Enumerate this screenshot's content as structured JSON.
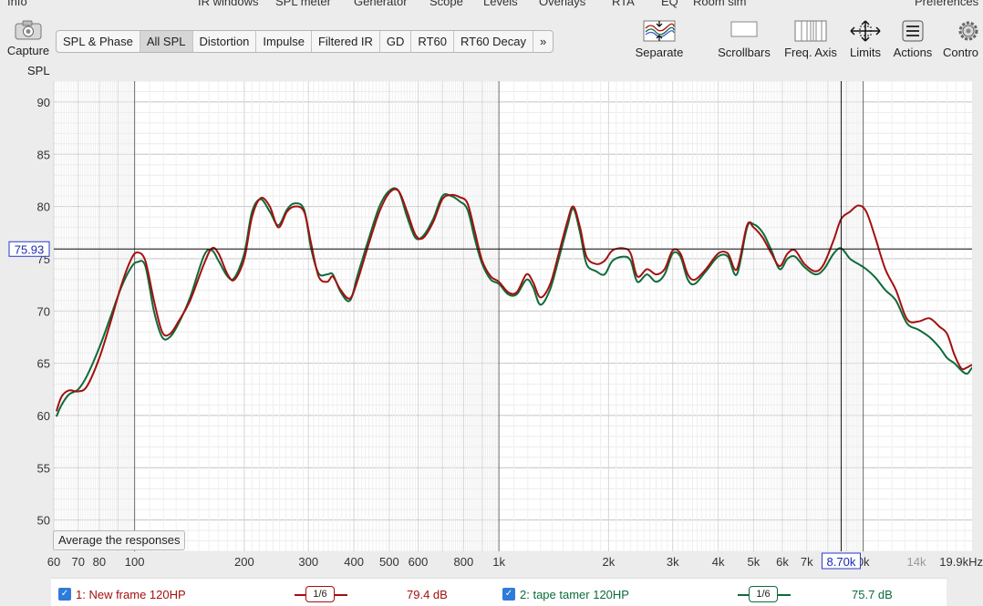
{
  "menu_top": [
    "Info",
    "IR windows",
    "SPL meter",
    "Generator",
    "Scope",
    "Levels",
    "Overlays",
    "RTA",
    "EQ",
    "Room sim",
    "Preferences"
  ],
  "toolbar": {
    "capture_label": "Capture",
    "separate_label": "Separate",
    "scrollbars_label": "Scrollbars",
    "freq_axis_label": "Freq. Axis",
    "limits_label": "Limits",
    "actions_label": "Actions",
    "controls_label": "Contro"
  },
  "tabs": [
    "SPL & Phase",
    "All SPL",
    "Distortion",
    "Impulse",
    "Filtered IR",
    "GD",
    "RT60",
    "RT60 Decay",
    "»"
  ],
  "active_tab": "All SPL",
  "average_button": "Average the responses",
  "legend": [
    {
      "label": "1: New frame 120HP",
      "smoothing": "1/6",
      "value": "79.4 dB",
      "color": "#a50f0f"
    },
    {
      "label": "2: tape tamer 120HP",
      "smoothing": "1/6",
      "value": "75.7 dB",
      "color": "#0d6b3a"
    }
  ],
  "chart_data": {
    "type": "line",
    "ylabel": "SPL",
    "xscale": "log",
    "xlim": [
      60,
      19900
    ],
    "ylim": [
      47,
      92
    ],
    "y_ticks": [
      50,
      55,
      60,
      65,
      70,
      75,
      80,
      85,
      90
    ],
    "x_ticks": [
      {
        "v": 60,
        "label": "60"
      },
      {
        "v": 70,
        "label": "70"
      },
      {
        "v": 80,
        "label": "80"
      },
      {
        "v": 100,
        "label": "100"
      },
      {
        "v": 200,
        "label": "200"
      },
      {
        "v": 300,
        "label": "300"
      },
      {
        "v": 400,
        "label": "400"
      },
      {
        "v": 500,
        "label": "500"
      },
      {
        "v": 600,
        "label": "600"
      },
      {
        "v": 800,
        "label": "800"
      },
      {
        "v": 1000,
        "label": "1k"
      },
      {
        "v": 2000,
        "label": "2k"
      },
      {
        "v": 3000,
        "label": "3k"
      },
      {
        "v": 4000,
        "label": "4k"
      },
      {
        "v": 5000,
        "label": "5k"
      },
      {
        "v": 6000,
        "label": "6k"
      },
      {
        "v": 7000,
        "label": "7k"
      },
      {
        "v": 10000,
        "label": "0k"
      },
      {
        "v": 14000,
        "label": "14k",
        "light": true
      },
      {
        "v": 19900,
        "label": "19.9kHz"
      }
    ],
    "cursor": {
      "x": 8700,
      "y": 75.93,
      "x_label": "8.70k",
      "y_label": "75.93"
    },
    "series": [
      {
        "name": "1: New frame 120HP",
        "color": "#a50f0f",
        "points": [
          [
            61,
            60.4
          ],
          [
            63,
            61.8
          ],
          [
            66,
            62.4
          ],
          [
            70,
            62.3
          ],
          [
            74,
            62.8
          ],
          [
            80,
            65.5
          ],
          [
            86,
            69.0
          ],
          [
            92,
            72.5
          ],
          [
            98,
            75.0
          ],
          [
            102,
            75.6
          ],
          [
            107,
            74.8
          ],
          [
            113,
            71.0
          ],
          [
            119,
            68.0
          ],
          [
            125,
            67.8
          ],
          [
            132,
            69.0
          ],
          [
            142,
            71.0
          ],
          [
            155,
            74.5
          ],
          [
            163,
            76.0
          ],
          [
            170,
            75.5
          ],
          [
            180,
            73.5
          ],
          [
            188,
            73.0
          ],
          [
            200,
            75.0
          ],
          [
            210,
            79.0
          ],
          [
            222,
            80.8
          ],
          [
            235,
            80.0
          ],
          [
            248,
            78.0
          ],
          [
            262,
            79.5
          ],
          [
            275,
            80.0
          ],
          [
            292,
            79.5
          ],
          [
            305,
            76.5
          ],
          [
            320,
            73.3
          ],
          [
            338,
            72.8
          ],
          [
            350,
            73.3
          ],
          [
            368,
            72.0
          ],
          [
            390,
            71.2
          ],
          [
            410,
            73.0
          ],
          [
            440,
            76.5
          ],
          [
            470,
            79.5
          ],
          [
            500,
            81.3
          ],
          [
            530,
            81.5
          ],
          [
            560,
            79.5
          ],
          [
            590,
            77.3
          ],
          [
            620,
            77.0
          ],
          [
            660,
            78.5
          ],
          [
            700,
            80.7
          ],
          [
            740,
            81.1
          ],
          [
            780,
            80.9
          ],
          [
            820,
            80.3
          ],
          [
            860,
            77.5
          ],
          [
            900,
            74.8
          ],
          [
            950,
            73.3
          ],
          [
            1000,
            72.8
          ],
          [
            1060,
            71.8
          ],
          [
            1120,
            71.8
          ],
          [
            1190,
            73.5
          ],
          [
            1240,
            72.8
          ],
          [
            1300,
            71.3
          ],
          [
            1380,
            72.5
          ],
          [
            1460,
            75.5
          ],
          [
            1540,
            78.5
          ],
          [
            1600,
            80.0
          ],
          [
            1670,
            78.0
          ],
          [
            1740,
            75.2
          ],
          [
            1850,
            74.5
          ],
          [
            1950,
            74.8
          ],
          [
            2050,
            75.8
          ],
          [
            2200,
            76.0
          ],
          [
            2300,
            75.5
          ],
          [
            2400,
            73.3
          ],
          [
            2550,
            74.0
          ],
          [
            2700,
            73.5
          ],
          [
            2850,
            74.0
          ],
          [
            3000,
            75.8
          ],
          [
            3150,
            75.5
          ],
          [
            3300,
            73.5
          ],
          [
            3450,
            73.0
          ],
          [
            3700,
            74.0
          ],
          [
            4000,
            75.5
          ],
          [
            4250,
            75.5
          ],
          [
            4500,
            74.0
          ],
          [
            4800,
            78.2
          ],
          [
            5000,
            78.0
          ],
          [
            5300,
            77.0
          ],
          [
            5600,
            75.5
          ],
          [
            5900,
            74.3
          ],
          [
            6200,
            75.5
          ],
          [
            6500,
            75.8
          ],
          [
            6900,
            74.5
          ],
          [
            7400,
            73.8
          ],
          [
            7800,
            74.5
          ],
          [
            8300,
            76.8
          ],
          [
            8700,
            78.8
          ],
          [
            9200,
            79.5
          ],
          [
            9700,
            80.1
          ],
          [
            10200,
            79.5
          ],
          [
            10800,
            77.0
          ],
          [
            11500,
            74.0
          ],
          [
            12300,
            72.0
          ],
          [
            13200,
            69.2
          ],
          [
            14200,
            69.0
          ],
          [
            15200,
            69.3
          ],
          [
            16200,
            68.5
          ],
          [
            17000,
            67.8
          ],
          [
            17800,
            65.8
          ],
          [
            18600,
            64.5
          ],
          [
            19300,
            64.6
          ],
          [
            20000,
            64.8
          ],
          [
            20800,
            64.0
          ],
          [
            21800,
            63.3
          ]
        ]
      },
      {
        "name": "2: tape tamer 120HP",
        "color": "#0d6b3a",
        "points": [
          [
            61,
            59.9
          ],
          [
            63,
            61.0
          ],
          [
            66,
            62.0
          ],
          [
            70,
            62.5
          ],
          [
            74,
            63.8
          ],
          [
            80,
            66.5
          ],
          [
            86,
            69.5
          ],
          [
            92,
            72.3
          ],
          [
            98,
            74.2
          ],
          [
            102,
            74.7
          ],
          [
            107,
            74.3
          ],
          [
            113,
            70.0
          ],
          [
            119,
            67.5
          ],
          [
            125,
            67.5
          ],
          [
            132,
            68.8
          ],
          [
            142,
            71.3
          ],
          [
            155,
            75.3
          ],
          [
            163,
            75.8
          ],
          [
            170,
            74.8
          ],
          [
            180,
            73.3
          ],
          [
            188,
            73.2
          ],
          [
            200,
            75.5
          ],
          [
            210,
            79.5
          ],
          [
            222,
            80.7
          ],
          [
            235,
            79.5
          ],
          [
            248,
            78.2
          ],
          [
            262,
            79.7
          ],
          [
            275,
            80.3
          ],
          [
            292,
            79.7
          ],
          [
            305,
            76.0
          ],
          [
            320,
            73.6
          ],
          [
            338,
            73.5
          ],
          [
            350,
            73.5
          ],
          [
            368,
            71.8
          ],
          [
            390,
            71.0
          ],
          [
            410,
            73.5
          ],
          [
            440,
            77.0
          ],
          [
            470,
            80.0
          ],
          [
            500,
            81.5
          ],
          [
            530,
            81.5
          ],
          [
            560,
            79.0
          ],
          [
            590,
            77.0
          ],
          [
            620,
            77.2
          ],
          [
            660,
            78.8
          ],
          [
            700,
            81.0
          ],
          [
            740,
            81.0
          ],
          [
            780,
            80.5
          ],
          [
            820,
            79.7
          ],
          [
            860,
            76.8
          ],
          [
            900,
            74.5
          ],
          [
            950,
            73.0
          ],
          [
            1000,
            72.6
          ],
          [
            1060,
            71.6
          ],
          [
            1120,
            71.6
          ],
          [
            1190,
            73.0
          ],
          [
            1240,
            72.3
          ],
          [
            1300,
            70.6
          ],
          [
            1380,
            72.0
          ],
          [
            1460,
            75.0
          ],
          [
            1540,
            78.0
          ],
          [
            1600,
            79.8
          ],
          [
            1670,
            77.5
          ],
          [
            1740,
            74.5
          ],
          [
            1850,
            73.8
          ],
          [
            1950,
            73.5
          ],
          [
            2050,
            74.8
          ],
          [
            2200,
            75.2
          ],
          [
            2300,
            74.8
          ],
          [
            2400,
            72.8
          ],
          [
            2550,
            73.5
          ],
          [
            2700,
            72.8
          ],
          [
            2850,
            73.5
          ],
          [
            3000,
            75.5
          ],
          [
            3150,
            75.2
          ],
          [
            3300,
            73.0
          ],
          [
            3450,
            72.6
          ],
          [
            3700,
            73.8
          ],
          [
            4000,
            75.2
          ],
          [
            4250,
            75.2
          ],
          [
            4500,
            73.5
          ],
          [
            4800,
            78.0
          ],
          [
            5000,
            78.3
          ],
          [
            5300,
            77.5
          ],
          [
            5600,
            75.8
          ],
          [
            5900,
            74.0
          ],
          [
            6200,
            75.0
          ],
          [
            6500,
            75.2
          ],
          [
            6900,
            74.2
          ],
          [
            7400,
            73.5
          ],
          [
            7800,
            74.0
          ],
          [
            8300,
            75.5
          ],
          [
            8700,
            76.0
          ],
          [
            9200,
            75.0
          ],
          [
            9700,
            74.5
          ],
          [
            10200,
            74.0
          ],
          [
            10800,
            73.2
          ],
          [
            11500,
            72.0
          ],
          [
            12300,
            71.0
          ],
          [
            13200,
            68.8
          ],
          [
            14200,
            68.2
          ],
          [
            15200,
            67.5
          ],
          [
            16200,
            66.5
          ],
          [
            17000,
            65.5
          ],
          [
            17800,
            65.0
          ],
          [
            18600,
            64.3
          ],
          [
            19300,
            64.0
          ],
          [
            20000,
            64.6
          ],
          [
            20800,
            64.2
          ],
          [
            21800,
            63.0
          ]
        ]
      }
    ]
  }
}
